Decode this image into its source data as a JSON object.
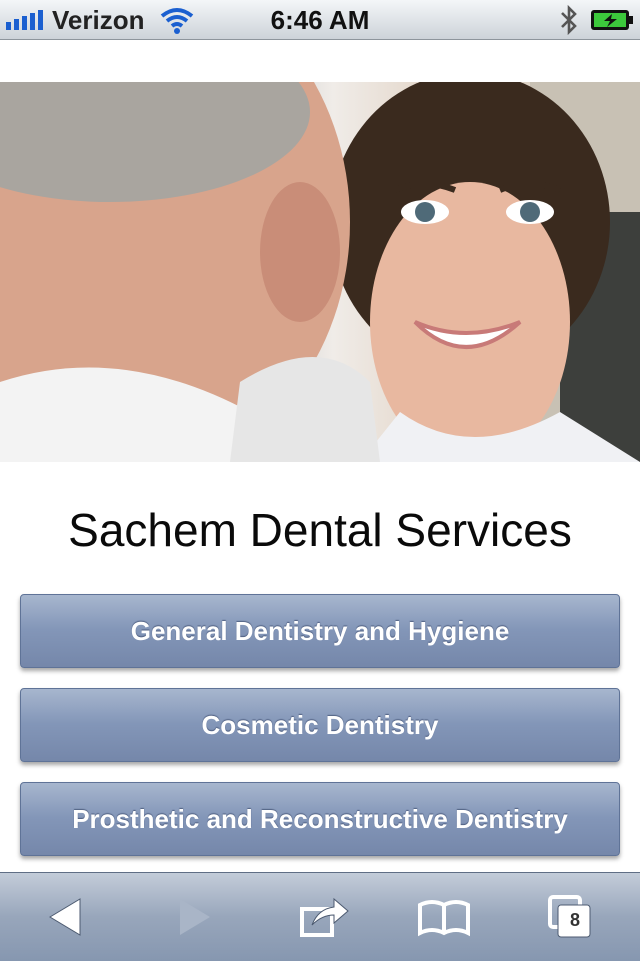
{
  "status_bar": {
    "carrier": "Verizon",
    "time": "6:46 AM",
    "battery_color": "#3cc83c"
  },
  "page": {
    "title": "Sachem Dental Services",
    "services": [
      {
        "label": "General Dentistry and Hygiene"
      },
      {
        "label": "Cosmetic Dentistry"
      },
      {
        "label": "Prosthetic and Reconstructive Dentistry"
      }
    ],
    "button_color": "#7f91b3"
  },
  "toolbar": {
    "back_icon": "back-arrow-icon",
    "forward_icon": "forward-arrow-icon",
    "share_icon": "share-icon",
    "bookmarks_icon": "bookmarks-icon",
    "tabs_icon": "tabs-icon",
    "tab_count": "8"
  }
}
